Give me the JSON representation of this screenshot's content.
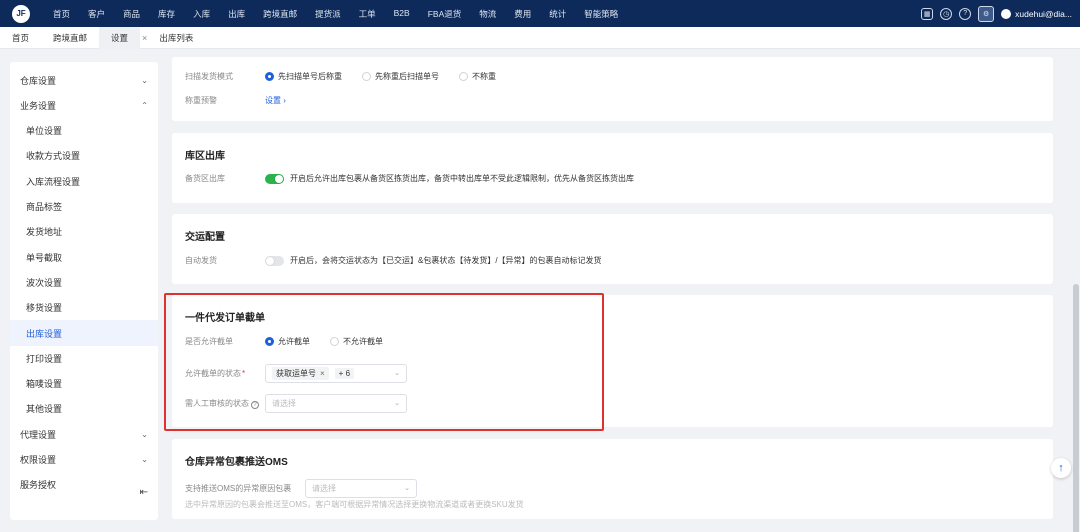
{
  "topnav": {
    "logo": "JF",
    "menu": [
      "首页",
      "客户",
      "商品",
      "库存",
      "入库",
      "出库",
      "跨境直邮",
      "提货派",
      "工单",
      "B2B",
      "FBA退货",
      "物流",
      "费用",
      "统计",
      "智能策略"
    ],
    "user": "xudehui@dia...",
    "icons": [
      "grid-icon",
      "clock-icon",
      "help-icon",
      "settings-icon"
    ]
  },
  "tabs": [
    {
      "label": "首页"
    },
    {
      "label": "跨境直邮"
    },
    {
      "label": "设置"
    },
    {
      "label": "出库列表"
    }
  ],
  "tab_close": "×",
  "sidebar": {
    "groups_top": [
      {
        "label": "仓库设置",
        "chev": "⌄"
      },
      {
        "label": "业务设置",
        "chev": "⌃"
      }
    ],
    "items": [
      "单位设置",
      "收款方式设置",
      "入库流程设置",
      "商品标签",
      "发货地址",
      "单号截取",
      "波次设置",
      "移货设置",
      "出库设置",
      "打印设置",
      "箱唛设置",
      "其他设置"
    ],
    "groups_bottom": [
      {
        "label": "代理设置",
        "chev": "⌄"
      },
      {
        "label": "权限设置",
        "chev": "⌄"
      },
      {
        "label": "服务授权",
        "chev": ""
      }
    ],
    "collapse_icon": "⇤"
  },
  "card1": {
    "row1_label": "扫描发货模式",
    "row1_options": [
      "先扫描单号后称重",
      "先称重后扫描单号",
      "不称重"
    ],
    "row2_label": "称重预警",
    "row2_link": "设置 ›"
  },
  "card2": {
    "title": "库区出库",
    "label": "备货区出库",
    "desc": "开启后允许出库包裹从备货区拣货出库，备货中转出库单不受此逻辑限制，优先从备货区拣货出库"
  },
  "card3": {
    "title": "交运配置",
    "label": "自动发货",
    "desc": "开启后，会将交运状态为【已交运】&包裹状态【待发货】/【异常】的包裹自动标记发货"
  },
  "card4": {
    "title": "一件代发订单截单",
    "row1_label": "是否允许截单",
    "row1_options": [
      "允许截单",
      "不允许截单"
    ],
    "row2_label": "允许截单的状态",
    "row2_required": "*",
    "row2_tag": "获取运单号",
    "row2_more": "+ 6",
    "row3_label": "需人工审核的状态",
    "row3_help": "?",
    "row3_placeholder": "请选择"
  },
  "card5": {
    "title": "仓库异常包裹推送OMS",
    "label": "支持推送OMS的异常原因包裹",
    "placeholder": "请选择",
    "note": "选中异常原因的包裹会推送至OMS，客户端可根据异常情况选择更换物流渠道或者更换SKU发货"
  },
  "backtop_icon": "↑",
  "colors": {
    "nav": "#0d2a5a",
    "accent": "#1f5fdc",
    "switch_on": "#2bb24c",
    "highlight": "#e03131"
  }
}
